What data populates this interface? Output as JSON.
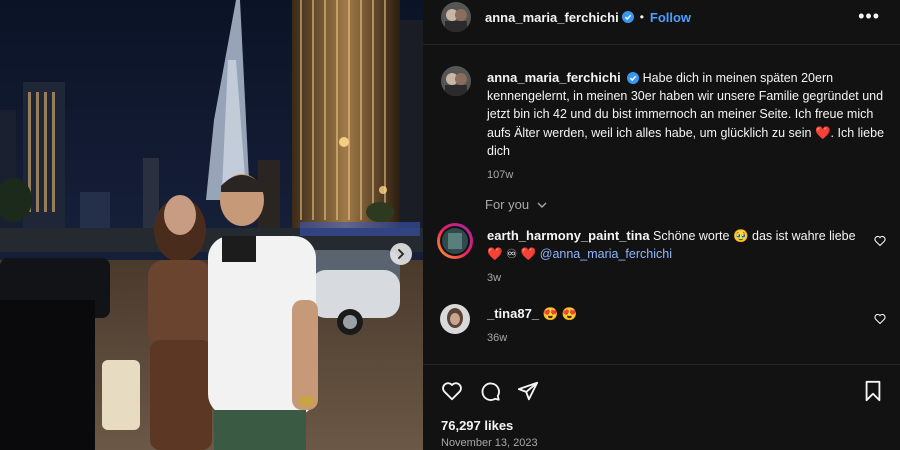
{
  "post": {
    "username": "anna_maria_ferchichi",
    "follow_label": "Follow",
    "separator": "•",
    "more_label": "•••"
  },
  "caption": {
    "username": "anna_maria_ferchichi",
    "text": "Habe dich in meinen späten 20ern kennengelernt, in meinen 30er haben wir unsere Familie gegründet und jetzt bin ich 42 und du bist immernoch an meiner Seite. Ich freue mich aufs Älter werden, weil ich alles habe, um glücklich zu sein",
    "emoji": "❤️",
    "text_end": ". Ich liebe dich",
    "time": "107w"
  },
  "for_you_label": "For you",
  "comments": [
    {
      "username": "earth_harmony_paint_tina",
      "text": "Schöne worte",
      "emoji1": "🥹",
      "text2": "das ist wahre liebe",
      "emoji2": "❤️ ♾ ❤️",
      "mention": "@anna_maria_ferchichi",
      "time": "3w"
    },
    {
      "username": "_tina87_",
      "emoji": "😍 😍",
      "time": "36w"
    }
  ],
  "footer": {
    "likes": "76,297 likes",
    "date": "November 13, 2023"
  },
  "icons": [
    "verified-icon",
    "more-icon",
    "chevron-down-icon",
    "heart-icon",
    "comment-icon",
    "share-icon",
    "save-icon",
    "next-arrow-icon"
  ],
  "colors": {
    "accent": "#4a9eff",
    "background": "#121212",
    "muted": "#a8a8a8"
  }
}
